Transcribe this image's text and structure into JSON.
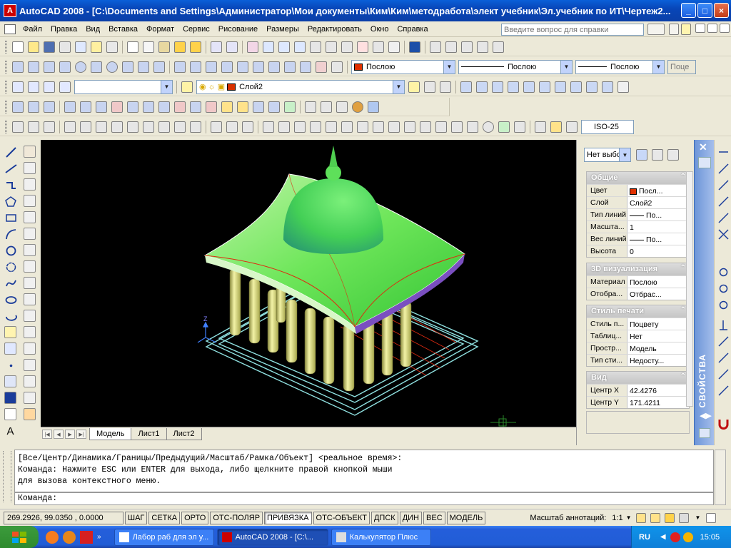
{
  "window": {
    "title": "AutoCAD 2008 - [C:\\Documents and Settings\\Администратор\\Мои документы\\Ким\\Ким\\методработа\\элект учебник\\Эл.учебник по ИТ\\Чертеж2...",
    "app_icon": "A",
    "min": "_",
    "max": "□",
    "close": "×"
  },
  "menu": {
    "items": [
      "Файл",
      "Правка",
      "Вид",
      "Вставка",
      "Формат",
      "Сервис",
      "Рисование",
      "Размеры",
      "Редактировать",
      "Окно",
      "Справка"
    ],
    "help_placeholder": "Введите вопрос для справки"
  },
  "toolbars": {
    "color_combo": "Послою",
    "linetype_combo": "Послою",
    "lineweight_combo": "Послою",
    "plotstyle_combo": "Поце",
    "layer_combo": "Слой2",
    "dimstyle_combo": "ISO-25",
    "colors": {
      "bylayer": "#e03000"
    }
  },
  "tabs": {
    "items": [
      "Модель",
      "Лист1",
      "Лист2"
    ],
    "active": 0
  },
  "properties": {
    "selection": "Нет выбо",
    "palette_title": "СВОЙСТВА",
    "sections": [
      {
        "title": "Общие",
        "rows": [
          [
            "Цвет",
            "Посл..."
          ],
          [
            "Слой",
            "Слой2"
          ],
          [
            "Тип линий",
            "По..."
          ],
          [
            "Масшта...",
            "1"
          ],
          [
            "Вес линий",
            "По..."
          ],
          [
            "Высота",
            "0"
          ]
        ]
      },
      {
        "title": "3D визуализация",
        "rows": [
          [
            "Материал",
            "Послою"
          ],
          [
            "Отобра...",
            "Отбрас..."
          ]
        ]
      },
      {
        "title": "Стиль печати",
        "rows": [
          [
            "Стиль п...",
            "Поцвету"
          ],
          [
            "Таблиц...",
            "Нет"
          ],
          [
            "Простр...",
            "Модель"
          ],
          [
            "Тип сти...",
            "Недосту..."
          ]
        ]
      },
      {
        "title": "Вид",
        "rows": [
          [
            "Центр X",
            "42.4276"
          ],
          [
            "Центр Y",
            "171.4211"
          ]
        ]
      }
    ]
  },
  "command": {
    "lines": [
      "[Все/Центр/Динамика/Границы/Предыдущий/Масштаб/Рамка/Объект] <реальное время>:",
      "Команда: Нажмите ESC или ENTER для выхода, либо щелкните правой кнопкой мыши",
      "для вызова контекстного меню."
    ],
    "prompt": "Команда:"
  },
  "status": {
    "coords": "269.2926, 99.0350 , 0.0000",
    "buttons": [
      "ШАГ",
      "СЕТКА",
      "ОРТО",
      "ОТС-ПОЛЯР",
      "ПРИВЯЗКА",
      "ОТС-ОБЪЕКТ",
      "ДПСК",
      "ДИН",
      "ВЕС",
      "МОДЕЛЬ"
    ],
    "on": [
      "ПРИВЯЗКА"
    ],
    "annotation_label": "Масштаб аннотаций:",
    "annotation_scale": "1:1"
  },
  "taskbar": {
    "tasks": [
      "Лабор раб для эл у...",
      "AutoCAD 2008 - [C:\\...",
      "Калькулятор Плюс"
    ],
    "active": 1,
    "lang": "RU",
    "time": "15:05"
  },
  "viewport": {
    "axis_label": "Z"
  }
}
